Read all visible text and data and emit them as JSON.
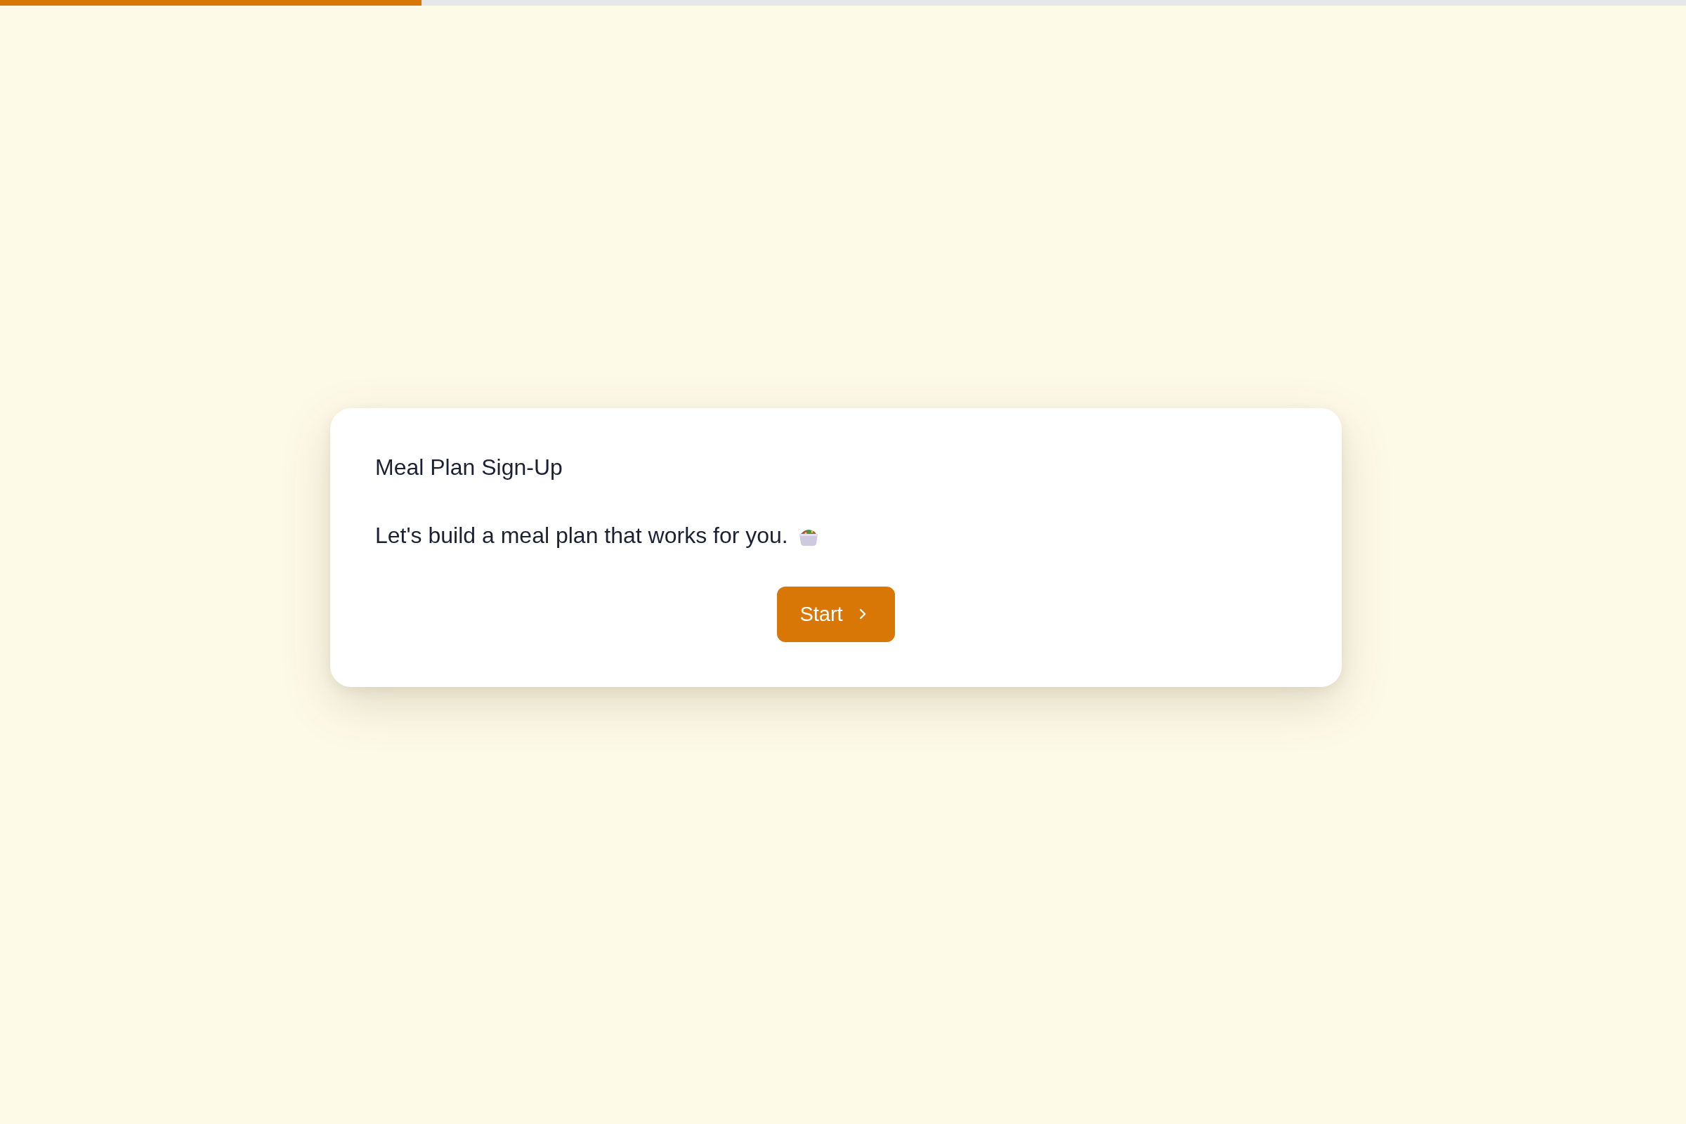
{
  "progress": {
    "level": 0.25
  },
  "card": {
    "title": "Meal Plan Sign-Up",
    "intro": "Let's build a meal plan that works for you.",
    "button": {
      "label": "Start"
    }
  }
}
